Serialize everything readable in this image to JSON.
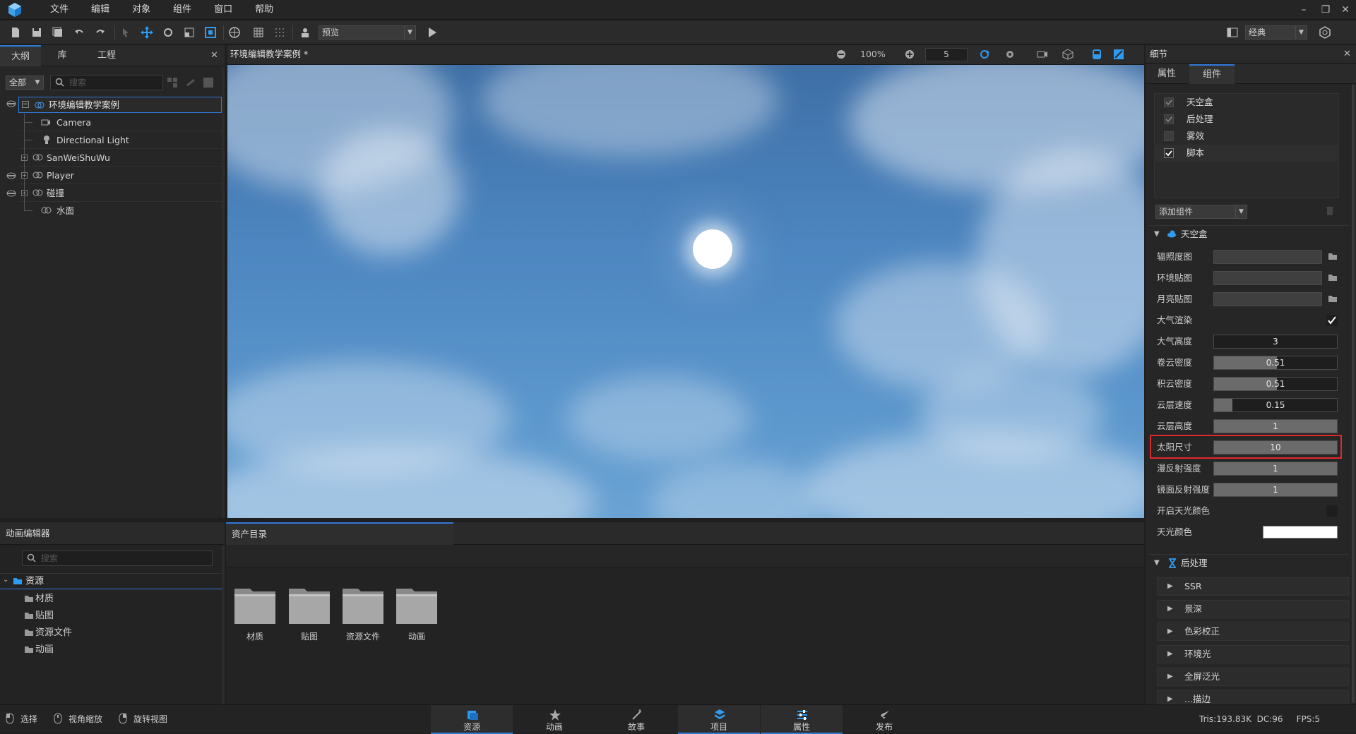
{
  "menu": {
    "items": [
      "文件",
      "编辑",
      "对象",
      "组件",
      "窗口",
      "帮助"
    ]
  },
  "toolbar": {
    "preview_select": "预览",
    "layout_select": "经典"
  },
  "outline": {
    "tabs": [
      "大纲",
      "库",
      "工程"
    ],
    "filter": "全部",
    "search_placeholder": "搜索",
    "tree": {
      "root": "环境编辑教学案例",
      "children": [
        "Camera",
        "Directional Light",
        "SanWeiShuWu",
        "Player",
        "碰撞",
        "水面"
      ]
    }
  },
  "viewport": {
    "title": "环境编辑教学案例 *",
    "zoom": "100%",
    "speed": "5"
  },
  "details": {
    "title": "细节",
    "tabs": [
      "属性",
      "组件"
    ],
    "components": [
      {
        "label": "天空盒",
        "checked": true,
        "dim": true
      },
      {
        "label": "后处理",
        "checked": true,
        "dim": true
      },
      {
        "label": "雾效",
        "checked": false,
        "dim": true
      },
      {
        "label": "脚本",
        "checked": true,
        "dim": false
      }
    ],
    "add_component": "添加组件",
    "skybox": {
      "header": "天空盒",
      "props": {
        "irradiance": "辐照度图",
        "env_map": "环境贴图",
        "moon_map": "月亮贴图",
        "atmosphere": "大气渲染",
        "atmo_height": {
          "label": "大气高度",
          "value": "3",
          "fill": 0
        },
        "cirrus": {
          "label": "卷云密度",
          "value": "0.51",
          "fill": 0.51
        },
        "cumulus": {
          "label": "积云密度",
          "value": "0.51",
          "fill": 0.51
        },
        "cloud_speed": {
          "label": "云层速度",
          "value": "0.15",
          "fill": 0.15
        },
        "cloud_height": {
          "label": "云层高度",
          "value": "1",
          "fill": 1
        },
        "sun_size": {
          "label": "太阳尺寸",
          "value": "10",
          "fill": 1
        },
        "diffuse": {
          "label": "漫反射强度",
          "value": "1",
          "fill": 1
        },
        "specular": {
          "label": "镜面反射强度",
          "value": "1",
          "fill": 1
        },
        "sky_color_enable": "开启天光颜色",
        "sky_color": {
          "label": "天光颜色",
          "value": "#ffffff"
        }
      }
    },
    "postprocess": {
      "header": "后处理",
      "items": [
        "SSR",
        "景深",
        "色彩校正",
        "环境光",
        "全屏泛光",
        "...描边"
      ]
    }
  },
  "anim_editor": {
    "title": "动画编辑器",
    "search_placeholder": "搜索",
    "root": "资源",
    "folders": [
      "材质",
      "贴图",
      "资源文件",
      "动画"
    ]
  },
  "assets": {
    "title": "资产目录",
    "folders": [
      "材质",
      "贴图",
      "资源文件",
      "动画"
    ]
  },
  "status": {
    "modes": [
      "选择",
      "视角缩放",
      "旋转视图"
    ],
    "tabs": [
      "资源",
      "动画",
      "故事",
      "项目",
      "属性",
      "发布"
    ],
    "stats": "Tris:193.83K  DC:96     FPS:5"
  },
  "colors": {
    "accent": "#2f7ad8",
    "highlight": "#e0282b"
  }
}
